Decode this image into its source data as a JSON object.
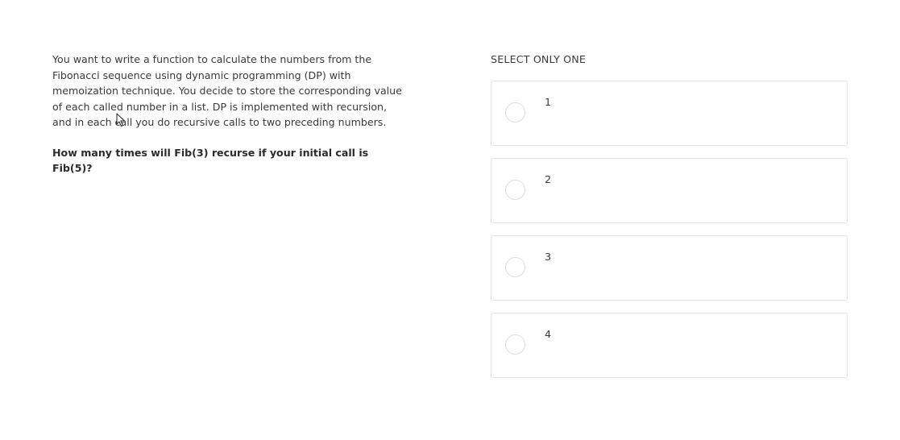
{
  "question": {
    "text": "You want to write a function to calculate the numbers from the Fibonacci sequence using dynamic programming (DP) with memoization technique. You decide to store the corresponding value of each called number in a list. DP is implemented with recursion, and in each call you do recursive calls to two preceding numbers.",
    "prompt": "How many times will Fib(3) recurse if your initial call is Fib(5)?"
  },
  "answers": {
    "instruction": "SELECT ONLY ONE",
    "options": [
      {
        "label": "1"
      },
      {
        "label": "2"
      },
      {
        "label": "3"
      },
      {
        "label": "4"
      }
    ]
  },
  "icons": {
    "cursor": "mouse-pointer-icon",
    "radio": "radio-circle-icon"
  }
}
